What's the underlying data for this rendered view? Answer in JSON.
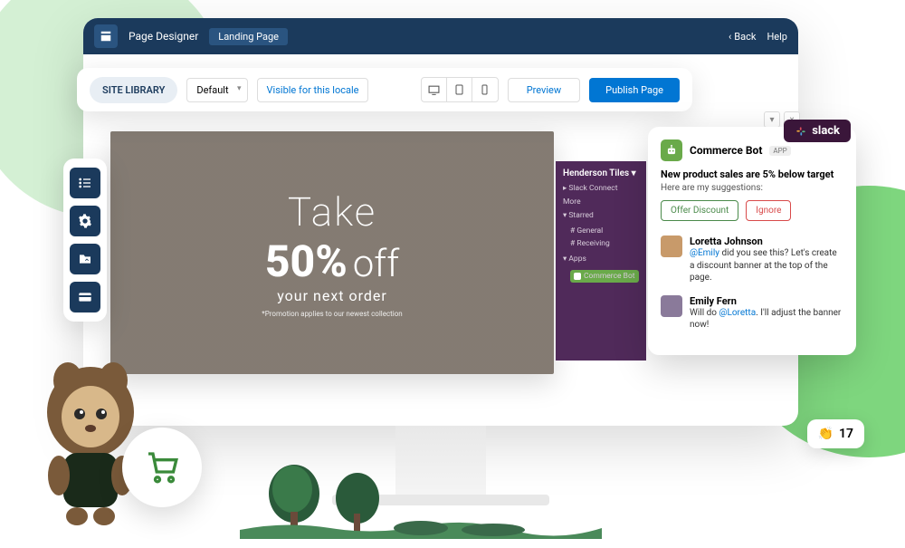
{
  "nav": {
    "title": "Page Designer",
    "tab": "Landing Page",
    "back": "Back",
    "help": "Help"
  },
  "toolbar": {
    "site_library": "SITE LIBRARY",
    "default": "Default",
    "visible": "Visible for this locale",
    "preview": "Preview",
    "publish": "Publish Page"
  },
  "promo": {
    "take": "Take",
    "fifty": "50%",
    "off": "off",
    "next": "your next order",
    "fine": "*Promotion applies to our newest collection"
  },
  "slack_sidebar": {
    "workspace": "Henderson Tiles",
    "connect": "Slack Connect",
    "more": "More",
    "starred": "Starred",
    "general": "General",
    "receiving": "Receiving",
    "apps": "Apps",
    "bot": "Commerce Bot"
  },
  "slack_badge": "slack",
  "bot": {
    "name": "Commerce Bot",
    "app": "APP",
    "alert": "New product sales are 5% below target",
    "suggest": "Here are my suggestions:",
    "offer": "Offer Discount",
    "ignore": "Ignore"
  },
  "msg1": {
    "name": "Loretta Johnson",
    "mention": "@Emily",
    "text": " did you see this? Let's create a discount banner at the top of the page."
  },
  "msg2": {
    "name": "Emily Fern",
    "pre": "Will do ",
    "mention": "@Loretta",
    "post": ". I'll adjust the banner now!"
  },
  "clap": {
    "count": "17"
  }
}
